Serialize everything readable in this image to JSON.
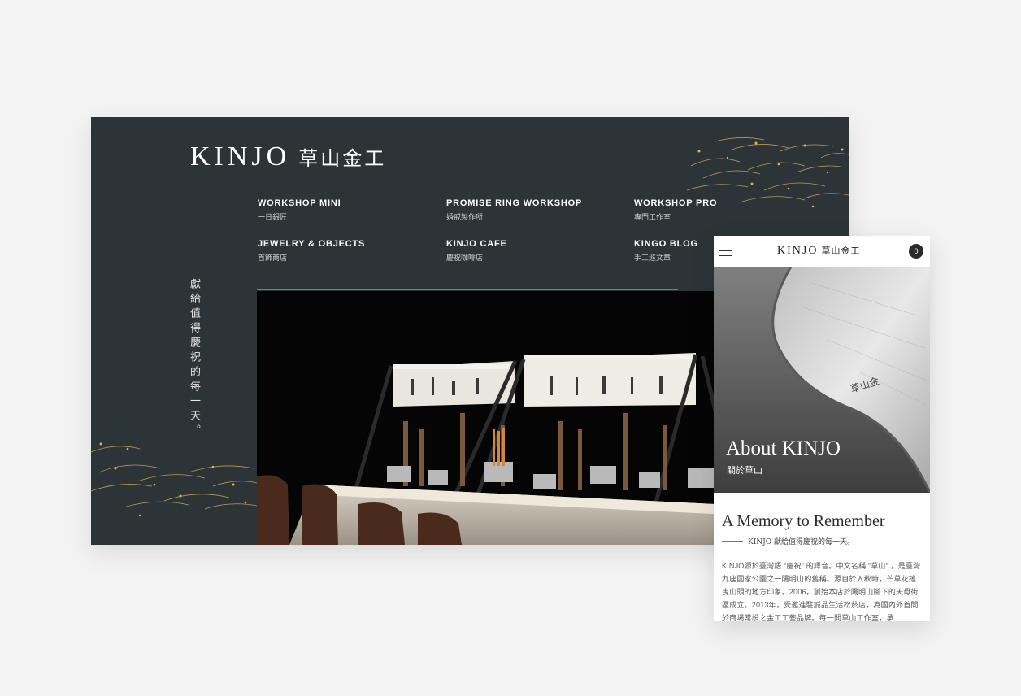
{
  "brand": {
    "en": "KINJO",
    "zh": "草山金工"
  },
  "nav": [
    {
      "en": "WORKSHOP MINI",
      "zh": "一日銀匠"
    },
    {
      "en": "PROMISE RING WORKSHOP",
      "zh": "婚戒製作所"
    },
    {
      "en": "WORKSHOP PRO",
      "zh": "專門工作室"
    },
    {
      "en": "JEWELRY & OBJECTS",
      "zh": "首飾商店"
    },
    {
      "en": "KINJO CAFE",
      "zh": "慶祝咖啡店"
    },
    {
      "en": "KINGO BLOG",
      "zh": "手工巡文章"
    }
  ],
  "tagline_vertical": "獻給值得慶祝的每一天。",
  "mobile": {
    "cart_count": "0",
    "hero_title": "About KINJO",
    "hero_subtitle": "關於草山",
    "section_title": "A Memory to Remember",
    "section_tag": "KINJO 獻給值得慶祝的每一天。",
    "body": "KINJO源於臺灣語 “慶祝” 的譯音。中文名稱 “草山” ，是臺灣九座國家公園之一陽明山的舊稱。源自於入秋時，芒草花搖曳山頭的地方印象。2006，創始本店於陽明山腳下的天母街區成立。2013年，受邀進駐誠品生活松菸店，為國內外首間於商場常設之金工工藝品牌。每一間草山工作室，承"
  },
  "colors": {
    "desktop_bg": "#2d3437",
    "page_bg": "#f3f3f3",
    "gold": "#c9a24a"
  }
}
